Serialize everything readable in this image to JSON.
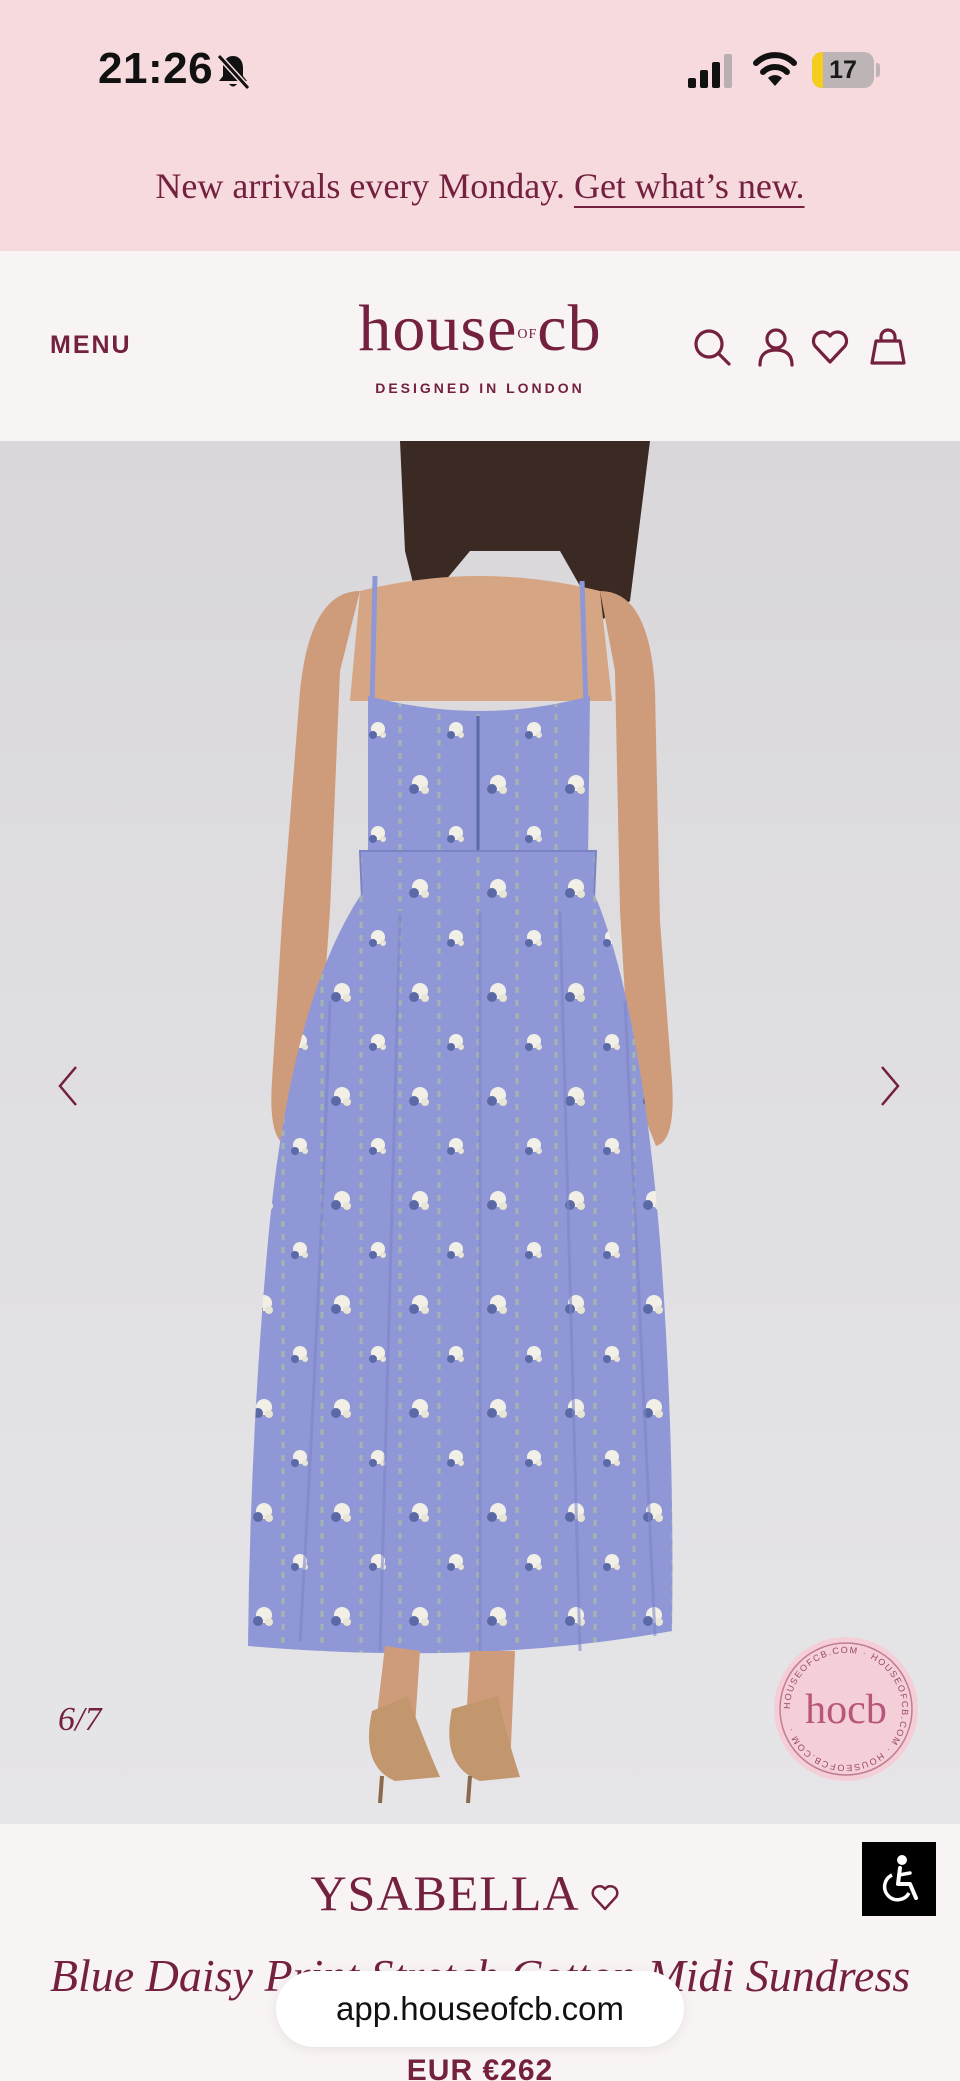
{
  "status_bar": {
    "time": "21:26",
    "battery_level": "17",
    "battery_fraction": 0.17,
    "signal_bars_active": 3,
    "signal_bars_total": 4
  },
  "promo": {
    "text": "New arrivals every Monday.",
    "link": "Get what’s new."
  },
  "header": {
    "menu_label": "MENU",
    "logo_word_1": "house",
    "logo_of": "OF",
    "logo_word_2": "cb",
    "logo_tagline": "DESIGNED IN LONDON",
    "icons": [
      "search-icon",
      "account-icon",
      "wishlist-icon",
      "bag-icon"
    ]
  },
  "gallery": {
    "counter": "6/7",
    "current_index": 6,
    "total": 7,
    "seal_text": "HOUSEOFCB.COM · HOUSEOFCB.COM · HOUSEOFCB.COM ·",
    "seal_mark": "hocb",
    "dress_color": "#8f97d6"
  },
  "product": {
    "name": "YSABELLA",
    "description": "Blue Daisy Print Stretch Cotton Midi Sundress",
    "price": "EUR €262"
  },
  "browser": {
    "url": "app.houseofcb.com"
  },
  "colors": {
    "brand": "#74203f",
    "banner_bg": "#f6dade",
    "page_bg": "#f9f4f4"
  }
}
